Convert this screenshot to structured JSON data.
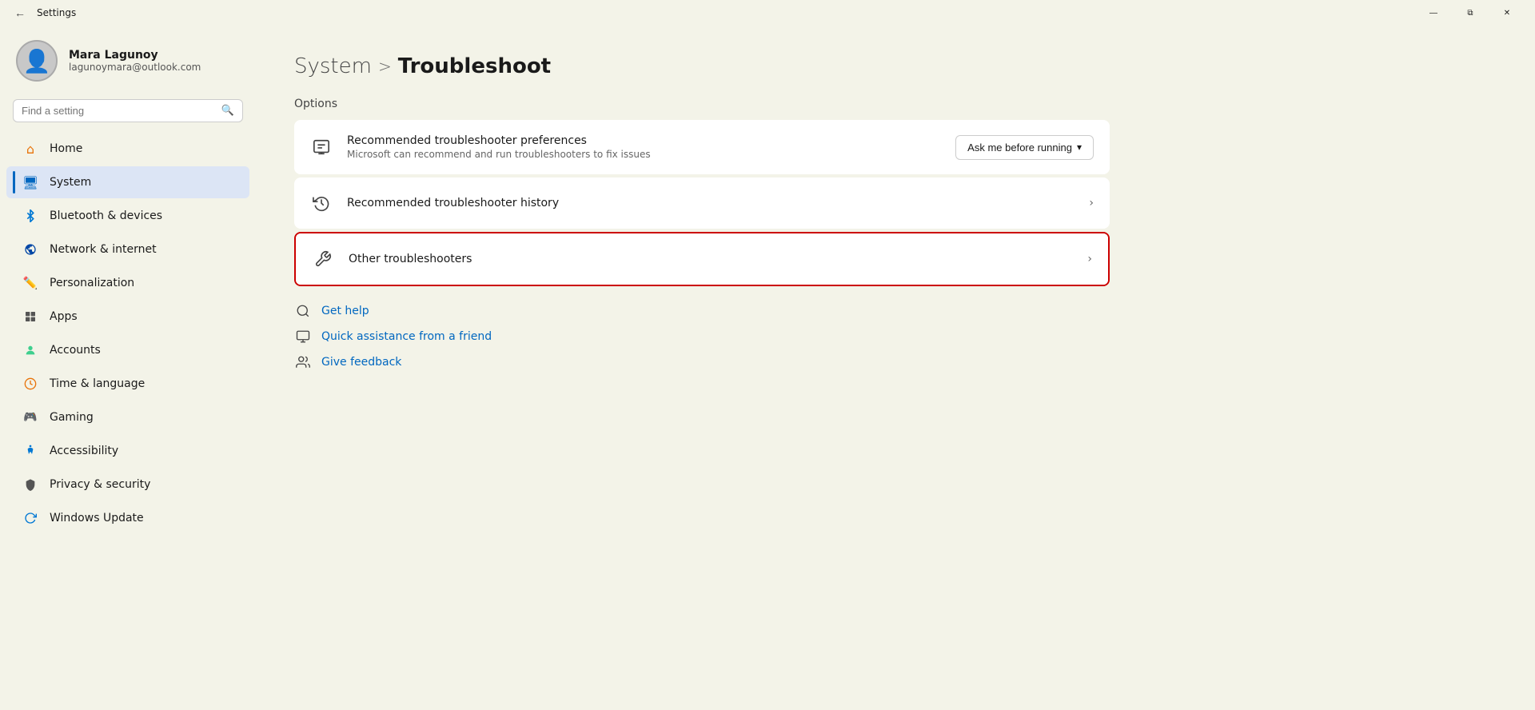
{
  "titlebar": {
    "title": "Settings",
    "back_label": "←",
    "minimize_label": "—",
    "restore_label": "⧉",
    "close_label": "✕"
  },
  "sidebar": {
    "user": {
      "name": "Mara Lagunoy",
      "email": "lagunoymara@outlook.com"
    },
    "search": {
      "placeholder": "Find a setting"
    },
    "nav_items": [
      {
        "id": "home",
        "label": "Home",
        "icon": "⌂"
      },
      {
        "id": "system",
        "label": "System",
        "icon": "🖥",
        "active": true
      },
      {
        "id": "bluetooth",
        "label": "Bluetooth & devices",
        "icon": "⬡"
      },
      {
        "id": "network",
        "label": "Network & internet",
        "icon": "◈"
      },
      {
        "id": "personalization",
        "label": "Personalization",
        "icon": "✏"
      },
      {
        "id": "apps",
        "label": "Apps",
        "icon": "⊞"
      },
      {
        "id": "accounts",
        "label": "Accounts",
        "icon": "◉"
      },
      {
        "id": "time",
        "label": "Time & language",
        "icon": "◔"
      },
      {
        "id": "gaming",
        "label": "Gaming",
        "icon": "🎮"
      },
      {
        "id": "accessibility",
        "label": "Accessibility",
        "icon": "♿"
      },
      {
        "id": "privacy",
        "label": "Privacy & security",
        "icon": "🛡"
      },
      {
        "id": "update",
        "label": "Windows Update",
        "icon": "↺"
      }
    ]
  },
  "main": {
    "breadcrumb": {
      "system": "System",
      "separator": ">",
      "current": "Troubleshoot"
    },
    "options_label": "Options",
    "cards": [
      {
        "id": "recommended-prefs",
        "title": "Recommended troubleshooter preferences",
        "subtitle": "Microsoft can recommend and run troubleshooters to fix issues",
        "action_type": "dropdown",
        "action_label": "Ask me before running",
        "highlighted": false
      },
      {
        "id": "recommended-history",
        "title": "Recommended troubleshooter history",
        "subtitle": "",
        "action_type": "chevron",
        "highlighted": false
      },
      {
        "id": "other-troubleshooters",
        "title": "Other troubleshooters",
        "subtitle": "",
        "action_type": "chevron",
        "highlighted": true
      }
    ],
    "help_links": [
      {
        "id": "get-help",
        "label": "Get help"
      },
      {
        "id": "quick-assistance",
        "label": "Quick assistance from a friend"
      },
      {
        "id": "give-feedback",
        "label": "Give feedback"
      }
    ]
  }
}
